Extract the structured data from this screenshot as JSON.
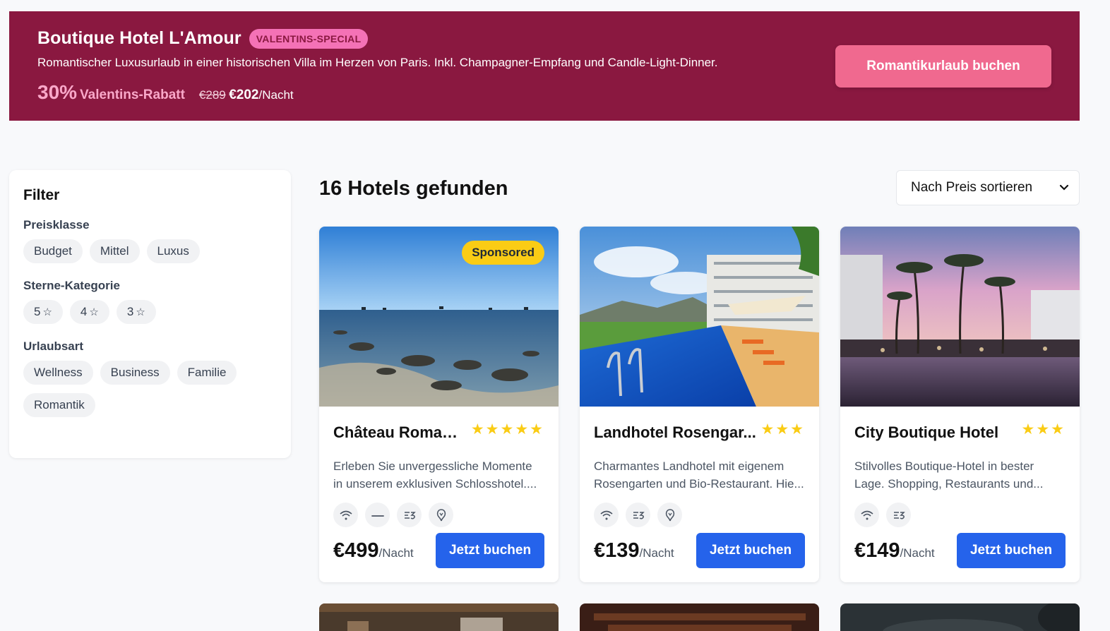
{
  "promo": {
    "title": "Boutique Hotel L'Amour",
    "badge": "VALENTINS-SPECIAL",
    "description": "Romantischer Luxusurlaub in einer historischen Villa im Herzen von Paris. Inkl. Champagner-Empfang und Candle-Light-Dinner.",
    "discount_pct": "30%",
    "discount_label": "Valentins-Rabatt",
    "old_price": "€289",
    "new_price": "€202",
    "unit": "/Nacht",
    "cta": "Romantikurlaub buchen",
    "colors": {
      "background": "#8a1840",
      "accent": "#f0698f"
    }
  },
  "filter": {
    "title": "Filter",
    "groups": [
      {
        "title": "Preisklasse",
        "options": [
          "Budget",
          "Mittel",
          "Luxus"
        ]
      },
      {
        "title": "Sterne-Kategorie",
        "options": [
          "5",
          "4",
          "3"
        ]
      },
      {
        "title": "Urlaubsart",
        "options": [
          "Wellness",
          "Business",
          "Familie",
          "Romantik"
        ]
      }
    ]
  },
  "results": {
    "title": "16 Hotels gefunden",
    "sort": {
      "selected": "Nach Preis sortieren"
    }
  },
  "hotels": [
    {
      "name": "Château Roman...",
      "stars": 5,
      "stars_text": "★★★★★",
      "sponsored": "Sponsored",
      "description": "Erleben Sie unvergessliche Momente in unserem exklusiven Schlosshotel....",
      "amenities": [
        "wifi-icon",
        "bathtub-icon",
        "restaurant-icon",
        "spa-icon"
      ],
      "price": "€499",
      "unit": "/Nacht",
      "cta": "Jetzt buchen"
    },
    {
      "name": "Landhotel Rosengar...",
      "stars": 3,
      "stars_text": "★★★",
      "description": "Charmantes Landhotel mit eigenem Rosengarten und Bio-Restaurant. Hie...",
      "amenities": [
        "wifi-icon",
        "restaurant-icon",
        "spa-icon"
      ],
      "price": "€139",
      "unit": "/Nacht",
      "cta": "Jetzt buchen"
    },
    {
      "name": "City Boutique Hotel",
      "stars": 3,
      "stars_text": "★★★",
      "description": "Stilvolles Boutique-Hotel in bester Lage. Shopping, Restaurants und...",
      "amenities": [
        "wifi-icon",
        "restaurant-icon"
      ],
      "price": "€149",
      "unit": "/Nacht",
      "cta": "Jetzt buchen"
    }
  ]
}
